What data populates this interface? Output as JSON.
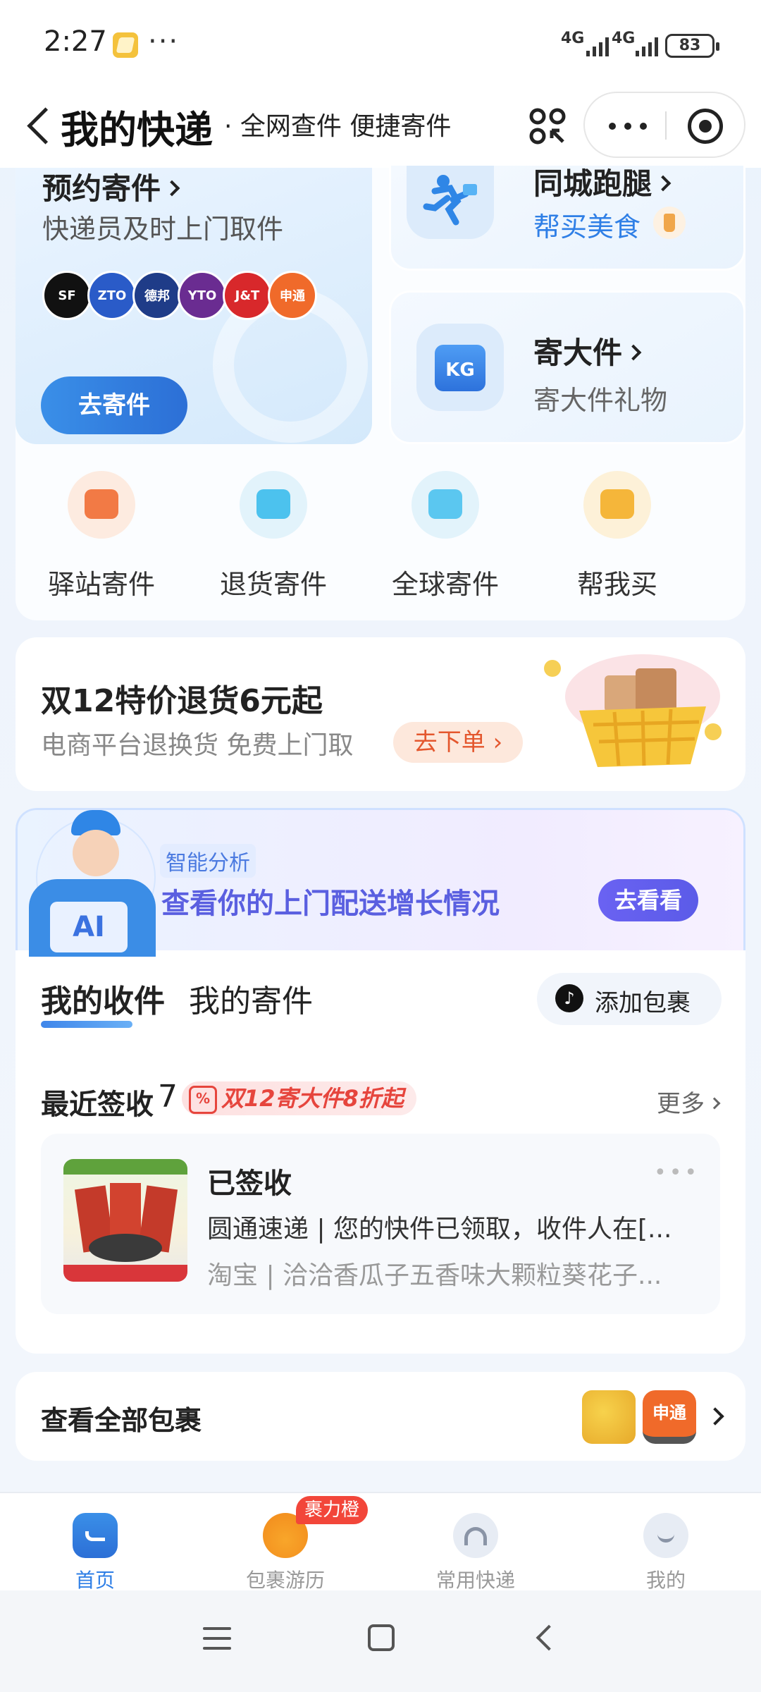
{
  "status_bar": {
    "time": "2:27",
    "more": "···",
    "signal1": "4G",
    "signal2": "4G",
    "battery": "83"
  },
  "header": {
    "title": "我的快递",
    "subtitle": "· 全网查件 便捷寄件"
  },
  "services": {
    "book_pickup": {
      "title": "预约寄件",
      "subtitle": "快递员及时上门取件",
      "button": "去寄件",
      "carriers": [
        {
          "name": "SF",
          "color": "#111111"
        },
        {
          "name": "ZTO",
          "color": "#2a5bc8"
        },
        {
          "name": "德邦",
          "color": "#1f3c88"
        },
        {
          "name": "YTO",
          "color": "#6a2c91"
        },
        {
          "name": "J&T",
          "color": "#d8282b"
        },
        {
          "name": "申通",
          "color": "#f06a2a"
        }
      ]
    },
    "city_runner": {
      "title": "同城跑腿",
      "subtitle": "帮买美食"
    },
    "large_item": {
      "title": "寄大件",
      "subtitle": "寄大件礼物",
      "icon_text": "KG"
    },
    "quick": [
      {
        "label": "驿站寄件",
        "icon": "station-icon",
        "bg": "#fdebe0",
        "fg": "#f27a45"
      },
      {
        "label": "退货寄件",
        "icon": "return-icon",
        "bg": "#e2f3fb",
        "fg": "#4cc2ee"
      },
      {
        "label": "全球寄件",
        "icon": "global-plane-icon",
        "bg": "#e2f3fb",
        "fg": "#5bc7f0"
      },
      {
        "label": "帮我买",
        "icon": "shopping-bag-icon",
        "bg": "#fdf1d8",
        "fg": "#f5b63a"
      }
    ]
  },
  "promo": {
    "title": "双12特价退货6元起",
    "subtitle": "电商平台退换货 免费上门取",
    "button": "去下单"
  },
  "ai_banner": {
    "tag": "智能分析",
    "title": "查看你的上门配送增长情况",
    "button": "去看看",
    "avatar_text": "AI"
  },
  "parcels": {
    "tabs": [
      "我的收件",
      "我的寄件"
    ],
    "add_button": "添加包裹",
    "recent_label": "最近签收",
    "recent_count": "7",
    "recent_badge": "双12寄大件8折起",
    "more": "更多",
    "item": {
      "status": "已签收",
      "line1": "圆通速递 | 您的快件已领取，收件人在[...",
      "line2": "淘宝 | 洽洽香瓜子五香味大颗粒葵花子..."
    }
  },
  "all_parcels": {
    "label": "查看全部包裹",
    "badge": "申通"
  },
  "tabbar": {
    "items": [
      {
        "label": "首页",
        "active": true
      },
      {
        "label": "包裹游历",
        "active": false,
        "badge": "裹力橙"
      },
      {
        "label": "常用快递",
        "active": false
      },
      {
        "label": "我的",
        "active": false
      }
    ]
  }
}
